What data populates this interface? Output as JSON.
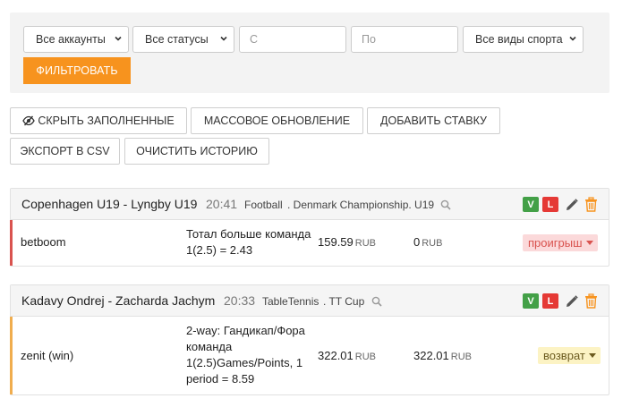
{
  "filters": {
    "accounts": "Все аккаунты",
    "statuses": "Все статусы",
    "date_from_placeholder": "С",
    "date_to_placeholder": "По",
    "sports": "Все виды спорта",
    "filter_button": "ФИЛЬТРОВАТЬ"
  },
  "toolbar": {
    "hide_filled": "СКРЫТЬ ЗАПОЛНЕННЫЕ",
    "mass_update": "МАССОВОЕ ОБНОВЛЕНИЕ",
    "add_bet": "ДОБАВИТЬ СТАВКУ",
    "export_csv": "ЭКСПОРТ В CSV",
    "clear_history": "ОЧИСТИТЬ ИСТОРИЮ"
  },
  "colors": {
    "accent": "#f7931e",
    "verify_green": "#43a047",
    "loss_red": "#e53935",
    "lost_stripe": "#d9534f",
    "return_stripe": "#f0ad4e",
    "lost_badge_bg": "#fbd9da",
    "lost_badge_text": "#d9534f",
    "return_badge_bg": "#fcf3c4",
    "return_badge_text": "#6b5a1e"
  },
  "bets": [
    {
      "match": "Copenhagen U19 - Lyngby U19",
      "time": "20:41",
      "sport": "Football",
      "league": ". Denmark Championship. U19",
      "badge_v": "V",
      "badge_l": "L",
      "bookmaker": "betboom",
      "description": "Тотал больше команда 1(2.5) = 2.43",
      "stake": "159.59",
      "stake_currency": "RUB",
      "payout": "0",
      "payout_currency": "RUB",
      "status": "проигрыш"
    },
    {
      "match": "Kadavy Ondrej - Zacharda Jachym",
      "time": "20:33",
      "sport": "TableTennis",
      "league": ". TT Cup",
      "badge_v": "V",
      "badge_l": "L",
      "bookmaker": "zenit (win)",
      "description": "2-way: Гандикап/Фора команда 1(2.5)Games/Points, 1 period = 8.59",
      "stake": "322.01",
      "stake_currency": "RUB",
      "payout": "322.01",
      "payout_currency": "RUB",
      "status": "возврат"
    }
  ]
}
